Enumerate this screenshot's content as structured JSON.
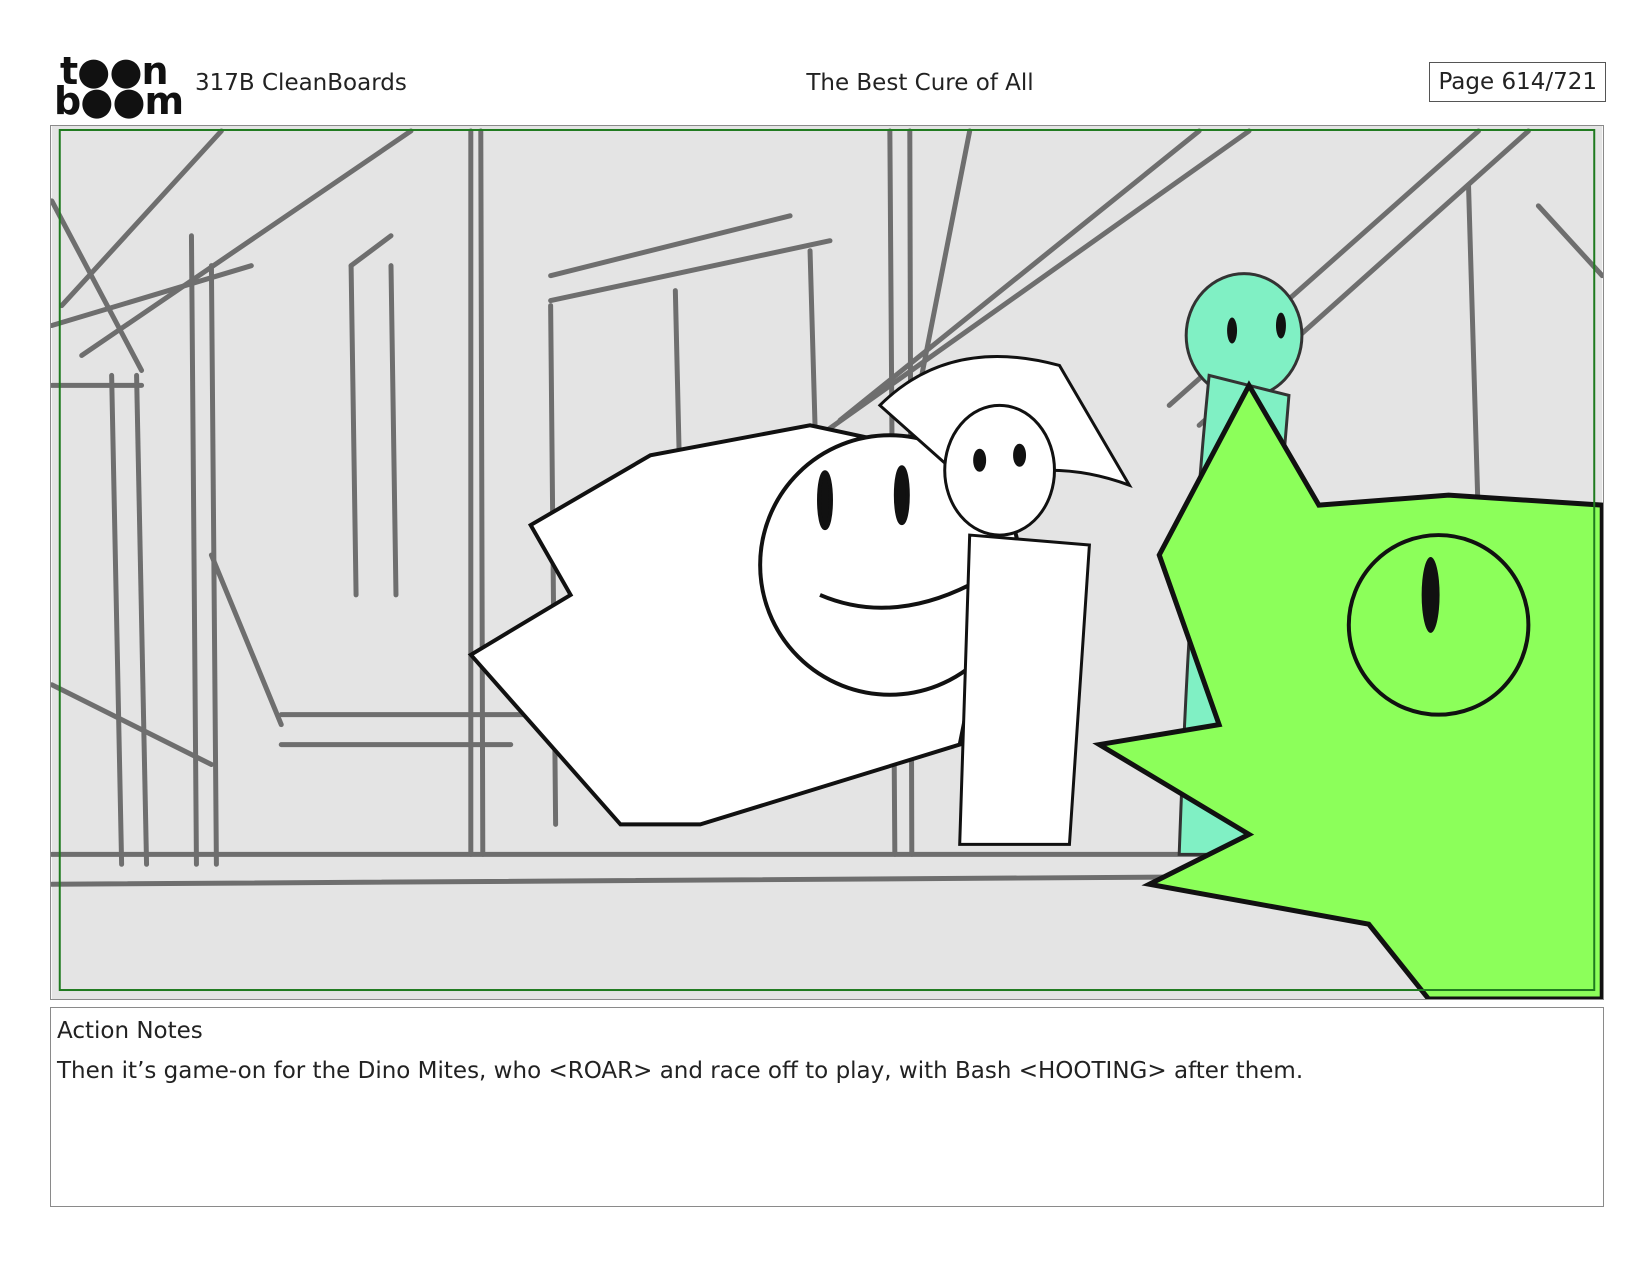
{
  "header": {
    "logo_line1": "t●●n",
    "logo_line2": "b●●m",
    "project": "317B  CleanBoards",
    "title": "The Best Cure of All",
    "page": "Page 614/721"
  },
  "panel": {
    "colors": {
      "background": "#e4e4e4",
      "safe_frame": "#1f7a1f",
      "dino_green": "#8cff5a",
      "dino_teal": "#80f0c4",
      "lines": "#6e6e6e",
      "ink": "#111111"
    }
  },
  "notes": {
    "label": "Action Notes",
    "text": "Then it’s game-on for the Dino Mites, who <ROAR> and race off to play, with Bash <HOOTING> after them."
  }
}
